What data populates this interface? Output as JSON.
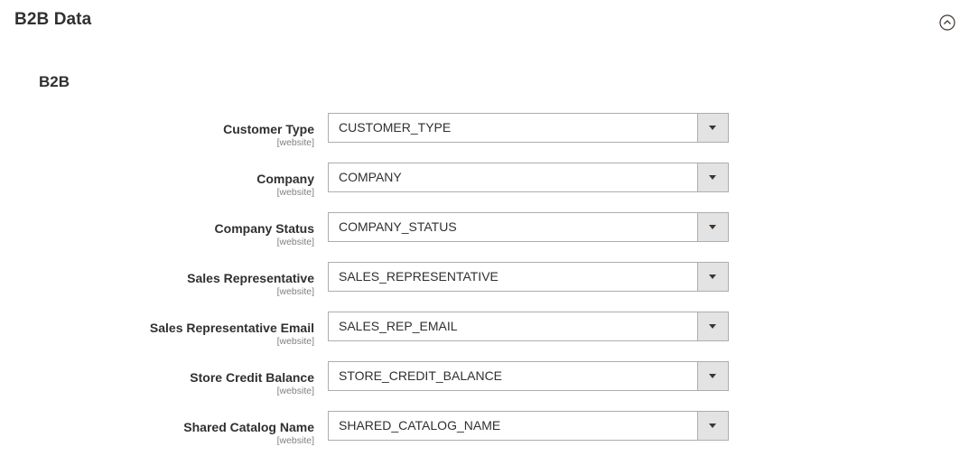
{
  "section": {
    "title": "B2B Data",
    "toggle_icon": "collapse-circle-icon"
  },
  "group": {
    "title": "B2B"
  },
  "fields": [
    {
      "label": "Customer Type",
      "scope": "[website]",
      "value": "CUSTOMER_TYPE"
    },
    {
      "label": "Company",
      "scope": "[website]",
      "value": "COMPANY"
    },
    {
      "label": "Company Status",
      "scope": "[website]",
      "value": "COMPANY_STATUS"
    },
    {
      "label": "Sales Representative",
      "scope": "[website]",
      "value": "SALES_REPRESENTATIVE"
    },
    {
      "label": "Sales Representative Email",
      "scope": "[website]",
      "value": "SALES_REP_EMAIL"
    },
    {
      "label": "Store Credit Balance",
      "scope": "[website]",
      "value": "STORE_CREDIT_BALANCE"
    },
    {
      "label": "Shared Catalog Name",
      "scope": "[website]",
      "value": "SHARED_CATALOG_NAME"
    }
  ],
  "colors": {
    "text": "#303030",
    "scope": "#808080",
    "border": "#adadad",
    "select_button": "#e3e3e3"
  }
}
